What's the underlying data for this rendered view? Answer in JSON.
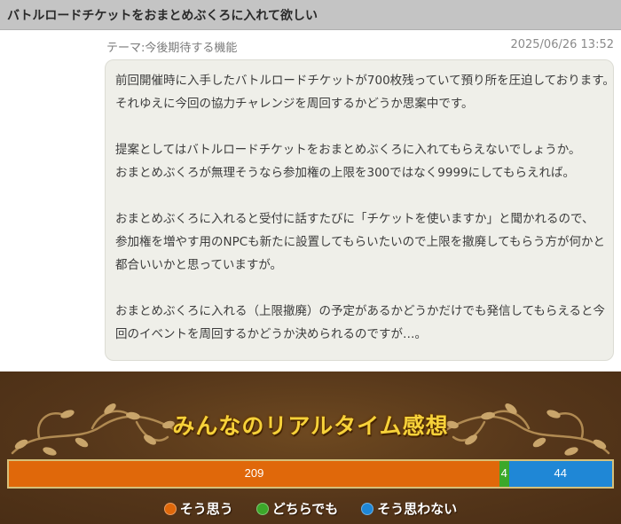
{
  "header": {
    "title": "バトルロードチケットをおまとめぶくろに入れて欲しい"
  },
  "meta": {
    "theme_label": "テーマ",
    "theme_separator": ":",
    "theme_value": "今後期待する機能",
    "date": "2025/06/26 13:52"
  },
  "post": {
    "paragraphs": [
      [
        "前回開催時に入手したバトルロードチケットが700枚残っていて預り所を圧迫しております。",
        "それゆえに今回の協力チャレンジを周回するかどうか思案中です。"
      ],
      [
        "提案としてはバトルロードチケットをおまとめぶくろに入れてもらえないでしょうか。",
        "おまとめぶくろが無理そうなら参加権の上限を300ではなく9999にしてもらえれば。"
      ],
      [
        "おまとめぶくろに入れると受付に話すたびに「チケットを使いますか」と聞かれるので、参加権を増やす用のNPCも新たに設置してもらいたいので上限を撤廃してもらう方が何かと都合いいかと思っていますが。"
      ],
      [
        "おまとめぶくろに入れる（上限撤廃）の予定があるかどうかだけでも発信してもらえると今回のイベントを周回するかどうか決められるのですが…。"
      ]
    ]
  },
  "realtime": {
    "title": "みんなのリアルタイム感想",
    "votes": {
      "agree": {
        "label": "そう思う",
        "count": 209,
        "count_text": "209",
        "color": "#e0680a"
      },
      "neutral": {
        "label": "どちらでも",
        "count": 4,
        "count_text": "4",
        "color": "#3ca82a"
      },
      "disagree": {
        "label": "そう思わない",
        "count": 44,
        "count_text": "44",
        "color": "#1f87d6"
      }
    }
  }
}
